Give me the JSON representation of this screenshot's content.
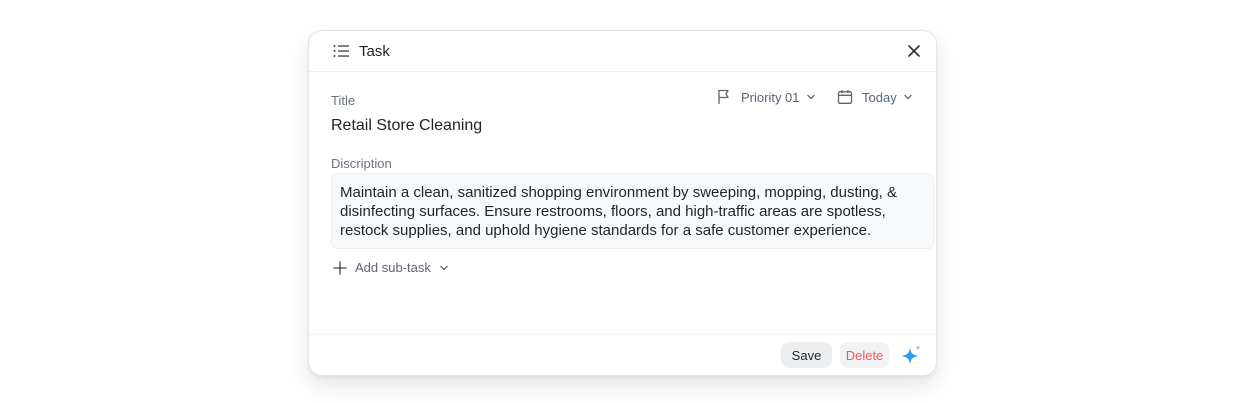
{
  "dialog": {
    "header_title": "Task",
    "title_label": "Title",
    "title_value": "Retail Store Cleaning",
    "priority_label": "Priority 01",
    "date_label": "Today",
    "description_label": "Discription",
    "description_value": "Maintain a clean, sanitized shopping environment by sweeping, mopping, dusting, & disinfecting surfaces. Ensure restrooms, floors, and high-traffic areas are spotless, restock supplies, and uphold hygiene standards for a safe customer experience.",
    "add_subtask_label": "Add sub-task"
  },
  "footer": {
    "save_label": "Save",
    "delete_label": "Delete"
  },
  "icons": {
    "list": "list-icon",
    "close": "close-icon",
    "flag": "flag-icon",
    "calendar": "calendar-icon",
    "chevron": "chevron-down-icon",
    "plus": "plus-icon",
    "sparkle": "sparkle-icon"
  },
  "colors": {
    "delete_text": "#ef5a5a",
    "sparkle_blue": "#2f9bf0",
    "sparkle_light": "#7cc7ff"
  }
}
